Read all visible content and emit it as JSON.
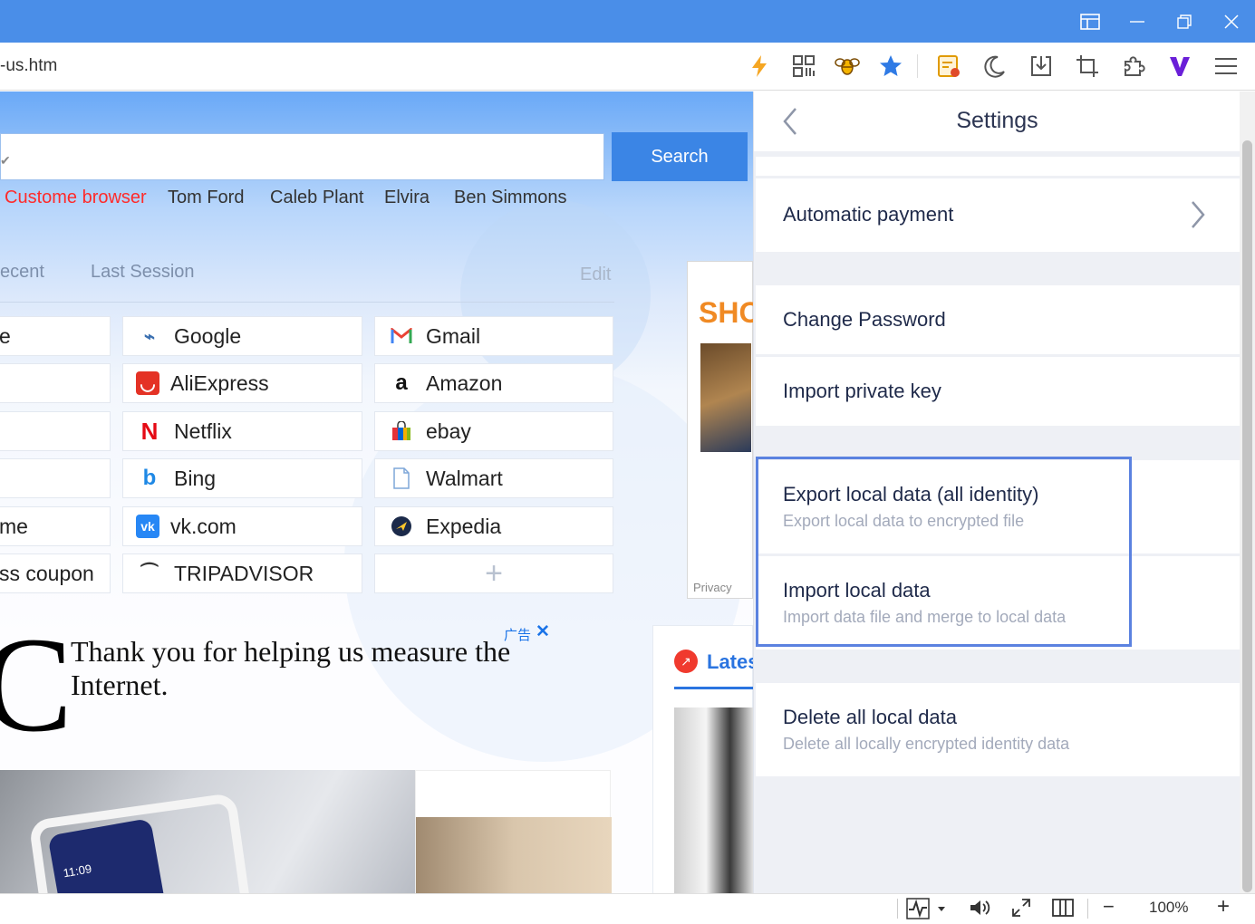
{
  "browser": {
    "url_fragment": "-us.htm",
    "window_buttons": [
      "sidebar-layout",
      "minimize",
      "restore",
      "close"
    ],
    "toolbar_icons": [
      "lightning-icon",
      "qr-code-icon",
      "bee-icon",
      "star-icon",
      "notes-icon",
      "moon-icon",
      "download-icon",
      "crop-icon",
      "extensions-icon",
      "v-logo-icon",
      "menu-icon"
    ]
  },
  "newtab": {
    "search_button": "Search",
    "hot_words": [
      "Custome browser",
      "Tom Ford",
      "Caleb Plant",
      "Elvira",
      "Ben Simmons"
    ],
    "tabs": [
      "ecent",
      "Last Session"
    ],
    "edit_label": "Edit",
    "left_partial": [
      "e",
      "",
      "",
      "",
      "me",
      "ss coupon"
    ],
    "dials_col1": [
      "Google",
      "AliExpress",
      "Netflix",
      "Bing",
      "vk.com",
      "TRIPADVISOR"
    ],
    "dials_col2": [
      "Gmail",
      "Amazon",
      "ebay",
      "Walmart",
      "Expedia"
    ],
    "add_symbol": "+",
    "ad": {
      "letter": "C",
      "text": "Thank you for helping us measure the Internet.",
      "tag": "广告",
      "close": "✕",
      "privacy": "Privacy",
      "shop_text": "SHO"
    },
    "latest_label": "Lates",
    "phone_time": "11:09"
  },
  "settings": {
    "title": "Settings",
    "automatic_payment": "Automatic payment",
    "change_password": "Change Password",
    "import_private_key": "Import private key",
    "export_title": "Export local data (all identity)",
    "export_sub": "Export local data to encrypted file",
    "import_title": "Import local data",
    "import_sub": "Import data file and merge to local data",
    "delete_title": "Delete all local data",
    "delete_sub": "Delete all locally encrypted identity data"
  },
  "statusbar": {
    "zoom": "100%",
    "minus": "−",
    "plus": "+"
  },
  "colors": {
    "titlebar": "#4a8ee8",
    "search_button": "#3b85e5",
    "highlight_border": "#5b82e0",
    "hot_first": "#ff2a2a"
  }
}
